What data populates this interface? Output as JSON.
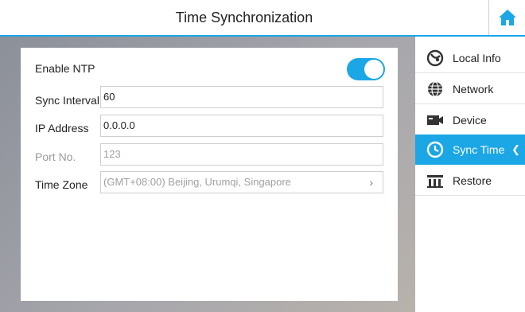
{
  "header": {
    "title": "Time Synchronization",
    "home_icon": "home-icon"
  },
  "form": {
    "enable_ntp": {
      "label": "Enable NTP",
      "enabled": true
    },
    "sync_interval": {
      "label": "Sync Interval",
      "value": "60"
    },
    "ip_address": {
      "label": "IP Address",
      "value": "0.0.0.0"
    },
    "port": {
      "label": "Port No.",
      "value": "123"
    },
    "time_zone": {
      "label": "Time Zone",
      "value": "(GMT+08:00) Beijing, Urumqi, Singapore"
    }
  },
  "sidebar": {
    "items": [
      {
        "label": "Local Info",
        "icon": "local-info-icon"
      },
      {
        "label": "Network",
        "icon": "globe-icon"
      },
      {
        "label": "Device",
        "icon": "device-icon"
      },
      {
        "label": "Sync Time",
        "icon": "clock-icon",
        "active": true
      },
      {
        "label": "Restore",
        "icon": "restore-icon"
      }
    ]
  },
  "colors": {
    "accent": "#1ba6e6"
  }
}
